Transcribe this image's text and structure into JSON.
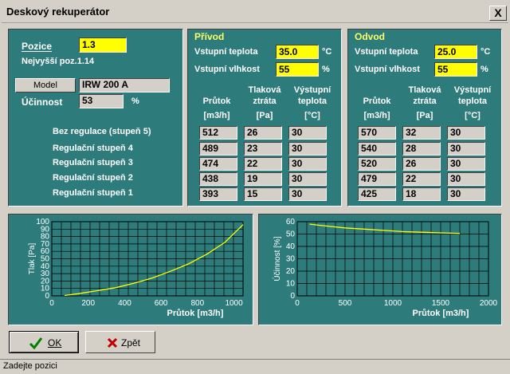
{
  "window": {
    "title": "Deskový rekuperátor",
    "close": "X"
  },
  "left": {
    "pozice_label": "Pozice",
    "pozice_value": "1.3",
    "nejvyssi": "Nejvyšší poz.1.14",
    "model_button": "Model",
    "model_value": "IRW 200 A",
    "ucinnost_label": "Účinnost",
    "ucinnost_value": "53",
    "ucinnost_unit": "%",
    "levels": [
      "Bez regulace (stupeň 5)",
      "Regulační stupeň 4",
      "Regulační stupeň 3",
      "Regulační stupeň 2",
      "Regulační stupeň 1"
    ]
  },
  "privod": {
    "title": "Přívod",
    "temp_label": "Vstupní teplota",
    "temp_value": "35.0",
    "temp_unit": "°C",
    "hum_label": "Vstupní vlhkost",
    "hum_value": "55",
    "hum_unit": "%",
    "h1": "Průtok",
    "h2a": "Tlaková",
    "h2b": "ztráta",
    "h3a": "Výstupní",
    "h3b": "teplota",
    "u1": "[m3/h]",
    "u2": "[Pa]",
    "u3": "[°C]",
    "rows": [
      [
        "512",
        "26",
        "30"
      ],
      [
        "489",
        "23",
        "30"
      ],
      [
        "474",
        "22",
        "30"
      ],
      [
        "438",
        "19",
        "30"
      ],
      [
        "393",
        "15",
        "30"
      ]
    ]
  },
  "odvod": {
    "title": "Odvod",
    "temp_label": "Vstupní teplota",
    "temp_value": "25.0",
    "temp_unit": "°C",
    "hum_label": "Vstupní vlhkost",
    "hum_value": "55",
    "hum_unit": "%",
    "h1": "Průtok",
    "h2a": "Tlaková",
    "h2b": "ztráta",
    "h3a": "Výstupní",
    "h3b": "teplota",
    "u1": "[m3/h]",
    "u2": "[Pa]",
    "u3": "[°C]",
    "rows": [
      [
        "570",
        "32",
        "30"
      ],
      [
        "540",
        "28",
        "30"
      ],
      [
        "520",
        "26",
        "30"
      ],
      [
        "479",
        "22",
        "30"
      ],
      [
        "425",
        "18",
        "30"
      ]
    ]
  },
  "chart_data": [
    {
      "type": "line",
      "xlabel": "Průtok [m3/h]",
      "ylabel": "Tlak [Pa]",
      "xlim": [
        0,
        1050
      ],
      "ylim": [
        0,
        100
      ],
      "xticks": [
        0,
        200,
        400,
        600,
        800,
        1000
      ],
      "yticks": [
        0,
        10,
        20,
        30,
        40,
        50,
        60,
        70,
        80,
        90,
        100
      ],
      "x": [
        70,
        150,
        250,
        350,
        450,
        550,
        650,
        750,
        850,
        950,
        1050
      ],
      "y": [
        0.5,
        3,
        7,
        11,
        17,
        24,
        33,
        43,
        56,
        72,
        96
      ],
      "grid": true,
      "series_color": "#ffff00"
    },
    {
      "type": "line",
      "xlabel": "Průtok [m3/h]",
      "ylabel": "Účinnost [%]",
      "xlim": [
        0,
        2000
      ],
      "ylim": [
        0,
        60
      ],
      "xticks": [
        0,
        500,
        1000,
        1500,
        2000
      ],
      "yticks": [
        0,
        10,
        20,
        30,
        40,
        50,
        60
      ],
      "x": [
        130,
        300,
        500,
        700,
        900,
        1100,
        1300,
        1500,
        1700
      ],
      "y": [
        58,
        56.5,
        55,
        54,
        53,
        52,
        51.5,
        51,
        50.5
      ],
      "grid": true,
      "series_color": "#ffff00"
    }
  ],
  "buttons": {
    "ok": "OK",
    "back": "Zpět"
  },
  "status": "Zadejte pozici"
}
